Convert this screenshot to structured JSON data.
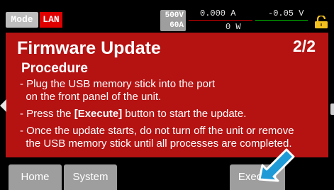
{
  "status": {
    "mode_label": "Mode",
    "lan_label": "LAN",
    "rating_voltage": "500V",
    "rating_current": "60A",
    "current_reading": "0.000 A",
    "voltage_reading": "-0.05 V",
    "power_reading": "0 W",
    "icons": {
      "lock": "lock-icon"
    }
  },
  "panel": {
    "title": "Firmware Update",
    "page_indicator": "2/2",
    "subtitle": "Procedure",
    "steps": [
      {
        "line1": "- Plug the USB memory stick into the port",
        "line2": "  on the front panel of the unit."
      },
      {
        "prefix": "- Press the ",
        "bold": "[Execute]",
        "suffix": " button to start the update."
      },
      {
        "line1": "- Once the update starts, do not turn off the unit or remove",
        "line2": "  the USB memory stick until all processes are completed."
      }
    ]
  },
  "buttons": {
    "home": "Home",
    "system": "System",
    "execute": "Execute"
  },
  "colors": {
    "panel_bg": "#b51212",
    "button_bg": "#9e9e9e",
    "lan_bg": "#e00000",
    "pointer": "#1e9bd7"
  }
}
